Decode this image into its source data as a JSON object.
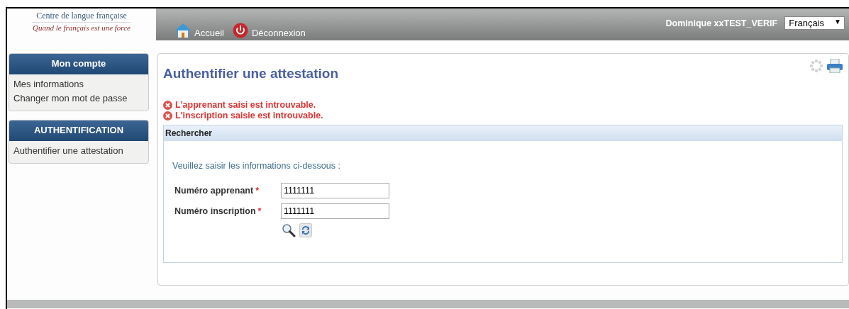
{
  "logo": {
    "title": "Centre de langue française",
    "tagline": "Quand le français est une force"
  },
  "nav": [
    {
      "label": "Accueil",
      "kind": "home"
    },
    {
      "label": "Déconnexion",
      "kind": "logout"
    }
  ],
  "user": "Dominique xxTEST_VERIF",
  "language": {
    "value": "Français",
    "arrow": "▼"
  },
  "sidebar": [
    {
      "title": "Mon compte",
      "items": [
        "Mes informations",
        "Changer mon mot de passe"
      ]
    },
    {
      "title": "AUTHENTIFICATION",
      "items": [
        "Authentifier une attestation"
      ]
    }
  ],
  "page_title": "Authentifier une attestation",
  "errors": [
    "L'apprenant saisi est introuvable.",
    "L'inscription saisie est introuvable."
  ],
  "panel": {
    "title": "Rechercher",
    "instructions": "Veuillez saisir les informations ci-dessous :",
    "fields": [
      {
        "label": "Numéro apprenant",
        "required_mark": "*",
        "value": "1111111"
      },
      {
        "label": "Numéro inscription",
        "required_mark": "*",
        "value": "1111111"
      }
    ]
  }
}
